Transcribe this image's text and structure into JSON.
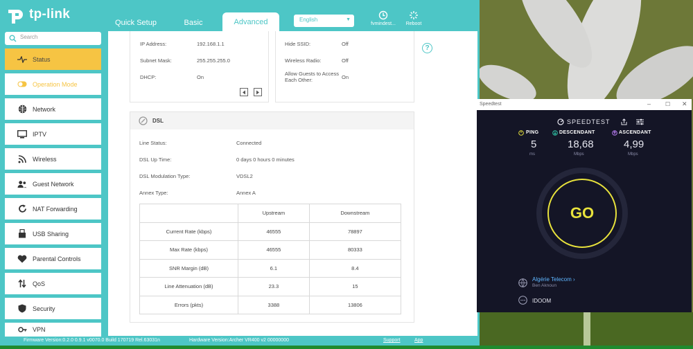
{
  "brand": {
    "name": "tp-link"
  },
  "nav": {
    "tabs": [
      {
        "label": "Quick Setup"
      },
      {
        "label": "Basic"
      },
      {
        "label": "Advanced"
      }
    ],
    "language": "English",
    "logout_label": "fvmindest...",
    "reboot_label": "Reboot"
  },
  "search": {
    "placeholder": "Search"
  },
  "sidebar": {
    "items": [
      {
        "label": "Status",
        "icon": "pulse-icon"
      },
      {
        "label": "Operation Mode",
        "icon": "toggle-icon"
      },
      {
        "label": "Network",
        "icon": "globe-icon"
      },
      {
        "label": "IPTV",
        "icon": "monitor-icon"
      },
      {
        "label": "Wireless",
        "icon": "wifi-icon"
      },
      {
        "label": "Guest Network",
        "icon": "users-icon"
      },
      {
        "label": "NAT Forwarding",
        "icon": "refresh-icon"
      },
      {
        "label": "USB Sharing",
        "icon": "usb-icon"
      },
      {
        "label": "Parental Controls",
        "icon": "heart-icon"
      },
      {
        "label": "QoS",
        "icon": "arrows-icon"
      },
      {
        "label": "Security",
        "icon": "shield-icon"
      },
      {
        "label": "VPN",
        "icon": "key-icon"
      }
    ]
  },
  "lan": {
    "ip_label": "IP Address:",
    "ip_value": "192.168.1.1",
    "mask_label": "Subnet Mask:",
    "mask_value": "255.255.255.0",
    "dhcp_label": "DHCP:",
    "dhcp_value": "On"
  },
  "wireless": {
    "ssid_label": "Hide SSID:",
    "ssid_value": "Off",
    "radio_label": "Wireless Radio:",
    "radio_value": "Off",
    "guests_label": "Allow Guests to Access Each Other:",
    "guests_value": "On"
  },
  "dsl": {
    "title": "DSL",
    "line_status_label": "Line Status:",
    "line_status_value": "Connected",
    "uptime_label": "DSL Up Time:",
    "uptime_value": "0 days 0 hours 0 minutes",
    "modulation_label": "DSL Modulation Type:",
    "modulation_value": "VDSL2",
    "annex_label": "Annex Type:",
    "annex_value": "Annex A",
    "table": {
      "headers": [
        "",
        "Upstream",
        "Downstream"
      ],
      "rows": [
        [
          "Current Rate (kbps)",
          "46555",
          "78897"
        ],
        [
          "Max Rate (kbps)",
          "46555",
          "80333"
        ],
        [
          "SNR Margin (dB)",
          "6.1",
          "8.4"
        ],
        [
          "Line Attenuation (dB)",
          "23.3",
          "15"
        ],
        [
          "Errors (pkts)",
          "3388",
          "13806"
        ]
      ]
    }
  },
  "footer": {
    "firmware": "Firmware Version:0.2.0 0.9.1 v0070.0 Build 170719 Rel.63031n",
    "hardware": "Hardware Version:Archer VR400 v2 00000000",
    "support": "Support",
    "app": "App"
  },
  "speedtest": {
    "window_title": "Speedtest",
    "logo": "SPEEDTEST",
    "ping_label": "PING",
    "ping_value": "5",
    "ping_unit": "ms",
    "down_label": "DESCENDANT",
    "down_value": "18,68",
    "down_unit": "Mbps",
    "up_label": "ASCENDANT",
    "up_value": "4,99",
    "up_unit": "Mbps",
    "go_label": "GO",
    "isp_name": "Algérie Telecom ›",
    "isp_location": "Ben Aknoun",
    "server_name": "IDOOM",
    "colors": {
      "go": "#e8e23c",
      "down": "#2ec4a6",
      "up": "#b87cf2"
    }
  },
  "colors": {
    "brand": "#4dc6c6",
    "active": "#f6c443"
  }
}
